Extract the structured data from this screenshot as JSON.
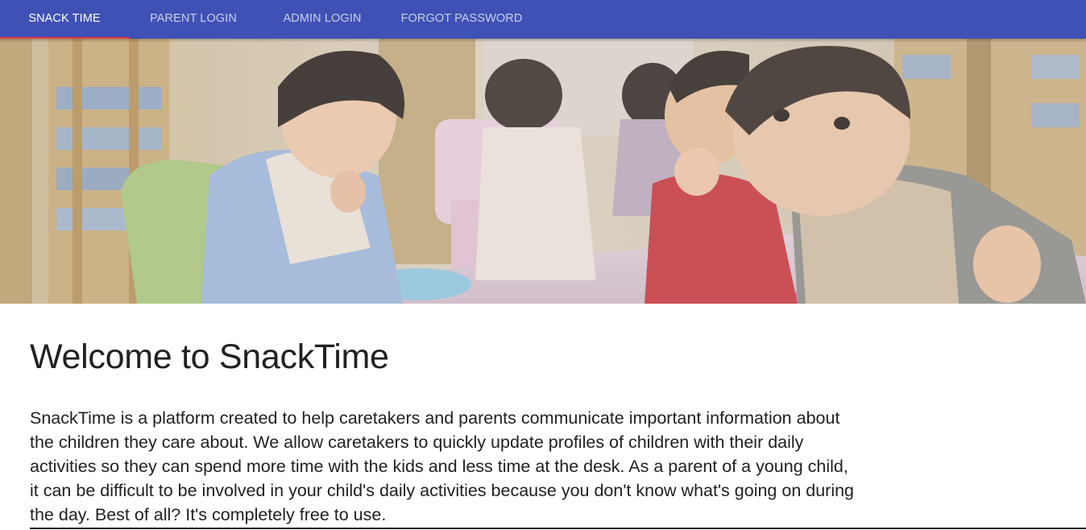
{
  "nav": {
    "tabs": [
      {
        "label": "SNACK TIME",
        "active": true
      },
      {
        "label": "PARENT LOGIN",
        "active": false
      },
      {
        "label": "ADMIN LOGIN",
        "active": false
      },
      {
        "label": "FORGOT PASSWORD",
        "active": false
      }
    ],
    "background_color": "#3f51b5",
    "indicator_color": "#e53935"
  },
  "hero": {
    "image": "children-eating-snacks-in-classroom"
  },
  "main": {
    "title": "Welcome to SnackTime",
    "description": "SnackTime is a platform created to help caretakers and parents communicate important information about the children they care about. We allow caretakers to quickly update profiles of children with their daily activities so they can spend more time with the kids and less time at the desk. As a parent of a young child, it can be difficult to be involved in your child's daily activities because you don't know what's going on during the day. Best of all? It's completely free to use."
  }
}
